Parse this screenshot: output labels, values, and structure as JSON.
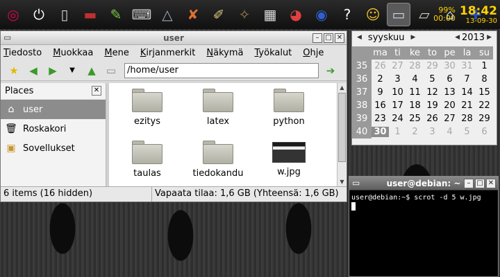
{
  "panel": {
    "launchers": [
      {
        "icon": "debian-swirl-icon",
        "glyph": "◎",
        "color": "#d70751"
      },
      {
        "icon": "power-icon",
        "glyph": "⏻",
        "color": "#ffffff"
      },
      {
        "icon": "computer-tower-icon",
        "glyph": "▯",
        "color": "#cfcfcf"
      },
      {
        "icon": "monitor-icon",
        "glyph": "▬",
        "color": "#c03030"
      },
      {
        "icon": "leaf-editor-icon",
        "glyph": "✎",
        "color": "#7ac943"
      },
      {
        "icon": "keyboard-icon",
        "glyph": "⌨",
        "color": "#cccccc"
      },
      {
        "icon": "inkscape-icon",
        "glyph": "△",
        "color": "#9ab"
      },
      {
        "icon": "xfig-icon",
        "glyph": "✘",
        "color": "#e07030"
      },
      {
        "icon": "paint-brush-icon",
        "glyph": "✐",
        "color": "#d9c27a"
      },
      {
        "icon": "gimp-icon",
        "glyph": "✧",
        "color": "#a08050"
      },
      {
        "icon": "spreadsheet-icon",
        "glyph": "▦",
        "color": "#dddddd"
      },
      {
        "icon": "pie-chart-icon",
        "glyph": "◕",
        "color": "#e04040"
      },
      {
        "icon": "network-globe-icon",
        "glyph": "◉",
        "color": "#3060d0"
      },
      {
        "icon": "help-icon",
        "glyph": "?",
        "color": "#ffffff"
      },
      {
        "icon": "avatar-icon",
        "glyph": "☺",
        "color": "#f0c030"
      },
      {
        "icon": "window-icon",
        "glyph": "▭",
        "color": "#c8d8e8"
      },
      {
        "icon": "folder-icon",
        "glyph": "▱",
        "color": "#d0d0c0"
      },
      {
        "icon": "network-monitor-icon",
        "glyph": "⌂",
        "color": "#b0c4de"
      },
      {
        "icon": "finnish-flag-icon",
        "glyph": "✚",
        "color": "#2050c0"
      }
    ],
    "battery": "99%",
    "battery_time": "00:00",
    "clock_time": "18:42",
    "clock_date": "13-09-30"
  },
  "file_manager": {
    "title": "user",
    "menus": [
      {
        "label": "Tiedosto",
        "u": "T",
        "rest": "iedosto"
      },
      {
        "label": "Muokkaa",
        "u": "M",
        "rest": "uokkaa"
      },
      {
        "label": "Mene",
        "u": "M",
        "rest": "ene"
      },
      {
        "label": "Kirjanmerkit",
        "u": "K",
        "rest": "irjanmerkit"
      },
      {
        "label": "Näkymä",
        "u": "N",
        "rest": "äkymä"
      },
      {
        "label": "Työkalut",
        "u": "T",
        "rest": "yökalut"
      },
      {
        "label": "Ohje",
        "u": "O",
        "rest": "hje"
      }
    ],
    "location": "/home/user",
    "sidebar_title": "Places",
    "places": [
      "user",
      "Roskakori",
      "Sovellukset"
    ],
    "files": [
      "ezitys",
      "latex",
      "python",
      "taulas",
      "tiedokandu",
      "w.jpg"
    ],
    "status_count": "6 items (16 hidden)",
    "status_space": "Vapaata tilaa: 1,6 GB (Yhteensä: 1,6 GB)"
  },
  "calendar": {
    "month": "syyskuu",
    "year": "2013",
    "weekdays": [
      "ma",
      "ti",
      "ke",
      "to",
      "pe",
      "la",
      "su"
    ],
    "weeks": [
      {
        "wk": "35",
        "days": [
          "26",
          "27",
          "28",
          "29",
          "30",
          "31",
          "1"
        ],
        "dim": [
          true,
          true,
          true,
          true,
          true,
          true,
          false
        ]
      },
      {
        "wk": "36",
        "days": [
          "2",
          "3",
          "4",
          "5",
          "6",
          "7",
          "8"
        ],
        "dim": [
          false,
          false,
          false,
          false,
          false,
          false,
          false
        ]
      },
      {
        "wk": "37",
        "days": [
          "9",
          "10",
          "11",
          "12",
          "13",
          "14",
          "15"
        ],
        "dim": [
          false,
          false,
          false,
          false,
          false,
          false,
          false
        ]
      },
      {
        "wk": "38",
        "days": [
          "16",
          "17",
          "18",
          "19",
          "20",
          "21",
          "22"
        ],
        "dim": [
          false,
          false,
          false,
          false,
          false,
          false,
          false
        ]
      },
      {
        "wk": "39",
        "days": [
          "23",
          "24",
          "25",
          "26",
          "27",
          "28",
          "29"
        ],
        "dim": [
          false,
          false,
          false,
          false,
          false,
          false,
          false
        ]
      },
      {
        "wk": "40",
        "days": [
          "30",
          "1",
          "2",
          "3",
          "4",
          "5",
          "6"
        ],
        "dim": [
          false,
          true,
          true,
          true,
          true,
          true,
          true
        ]
      }
    ],
    "today": "30"
  },
  "terminal": {
    "title": "user@debian: ~",
    "line": "user@debian:~$ scrot -d 5 w.jpg"
  }
}
